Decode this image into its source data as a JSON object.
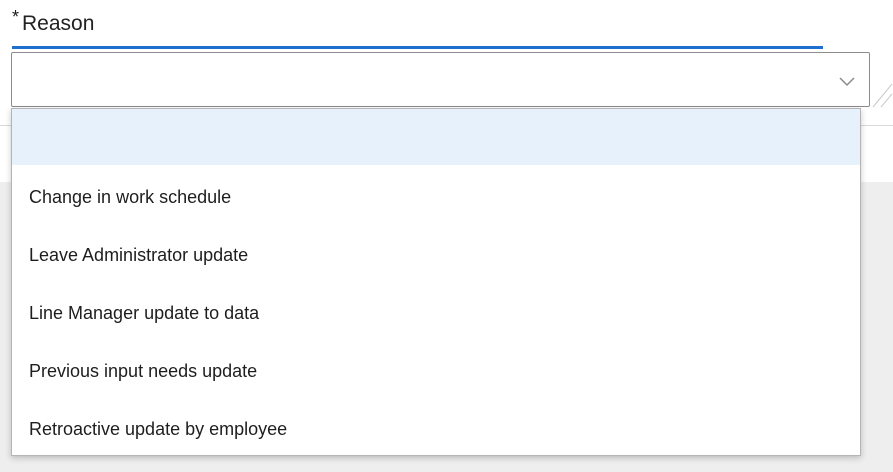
{
  "field": {
    "required_marker": "*",
    "label": "Reason",
    "value": ""
  },
  "icons": {
    "dropdown": "chevron-down-icon",
    "resize": "resize-handle-icon"
  },
  "colors": {
    "focus_underline": "#1f6fd1",
    "highlighted_option": "#e7f1fc",
    "lower_background": "#eeeeee"
  },
  "dropdown": {
    "highlighted_index": 0,
    "options": [
      "",
      "Change in work schedule",
      "Leave Administrator update",
      "Line Manager update to data",
      "Previous input needs update",
      "Retroactive update by employee"
    ]
  }
}
